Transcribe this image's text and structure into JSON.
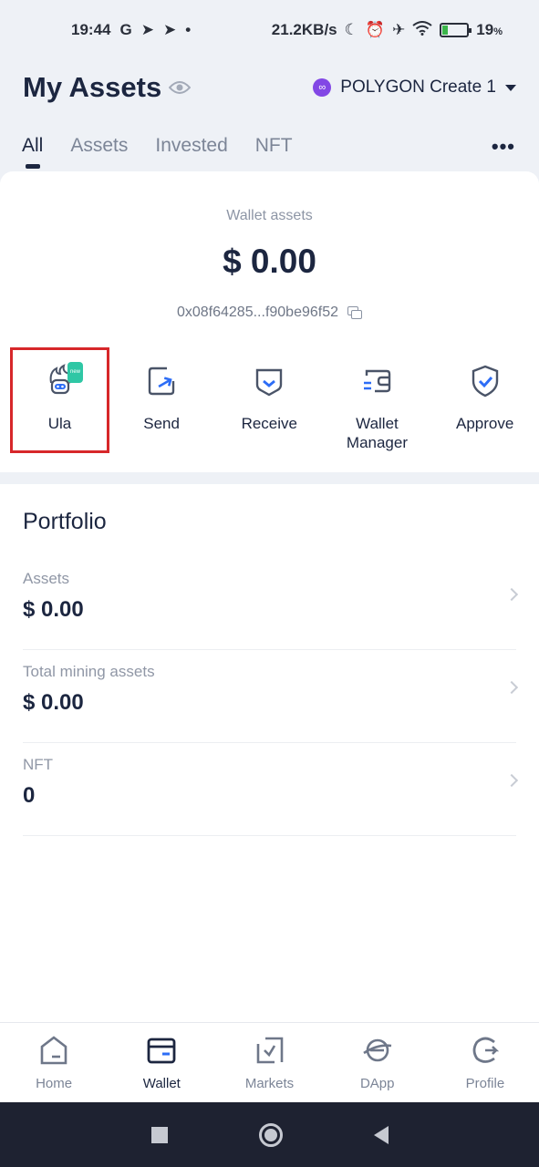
{
  "status_bar": {
    "time": "19:44",
    "g_icon": "G",
    "net_speed": "21.2KB/s",
    "battery_pct": "19",
    "battery_unit": "%",
    "battery_level": 0.19
  },
  "header": {
    "title": "My Assets",
    "network_name": "POLYGON Create 1",
    "network_icon": "∞"
  },
  "tabs": [
    {
      "label": "All",
      "active": true
    },
    {
      "label": "Assets",
      "active": false
    },
    {
      "label": "Invested",
      "active": false
    },
    {
      "label": "NFT",
      "active": false
    }
  ],
  "more_label": "•••",
  "wallet": {
    "label": "Wallet assets",
    "total": "$ 0.00",
    "address": "0x08f64285...f90be96f52"
  },
  "actions": [
    {
      "label": "Ula",
      "icon": "ula-robot-icon",
      "badge": "new"
    },
    {
      "label": "Send",
      "icon": "send-icon"
    },
    {
      "label": "Receive",
      "icon": "receive-icon"
    },
    {
      "label": "Wallet\nManager",
      "icon": "wallet-manager-icon"
    },
    {
      "label": "Approve",
      "icon": "approve-shield-icon"
    }
  ],
  "portfolio": {
    "title": "Portfolio",
    "rows": [
      {
        "label": "Assets",
        "value": "$ 0.00"
      },
      {
        "label": "Total mining assets",
        "value": "$ 0.00"
      },
      {
        "label": "NFT",
        "value": "0"
      }
    ]
  },
  "bottom_nav": [
    {
      "label": "Home",
      "icon": "home-icon",
      "active": false
    },
    {
      "label": "Wallet",
      "icon": "wallet-icon",
      "active": true
    },
    {
      "label": "Markets",
      "icon": "markets-icon",
      "active": false
    },
    {
      "label": "DApp",
      "icon": "dapp-icon",
      "active": false
    },
    {
      "label": "Profile",
      "icon": "profile-icon",
      "active": false
    }
  ],
  "colors": {
    "primary_text": "#1c2640",
    "accent_blue": "#2d6df6",
    "highlight_red": "#d7272a",
    "polygon_purple": "#8247e5"
  }
}
